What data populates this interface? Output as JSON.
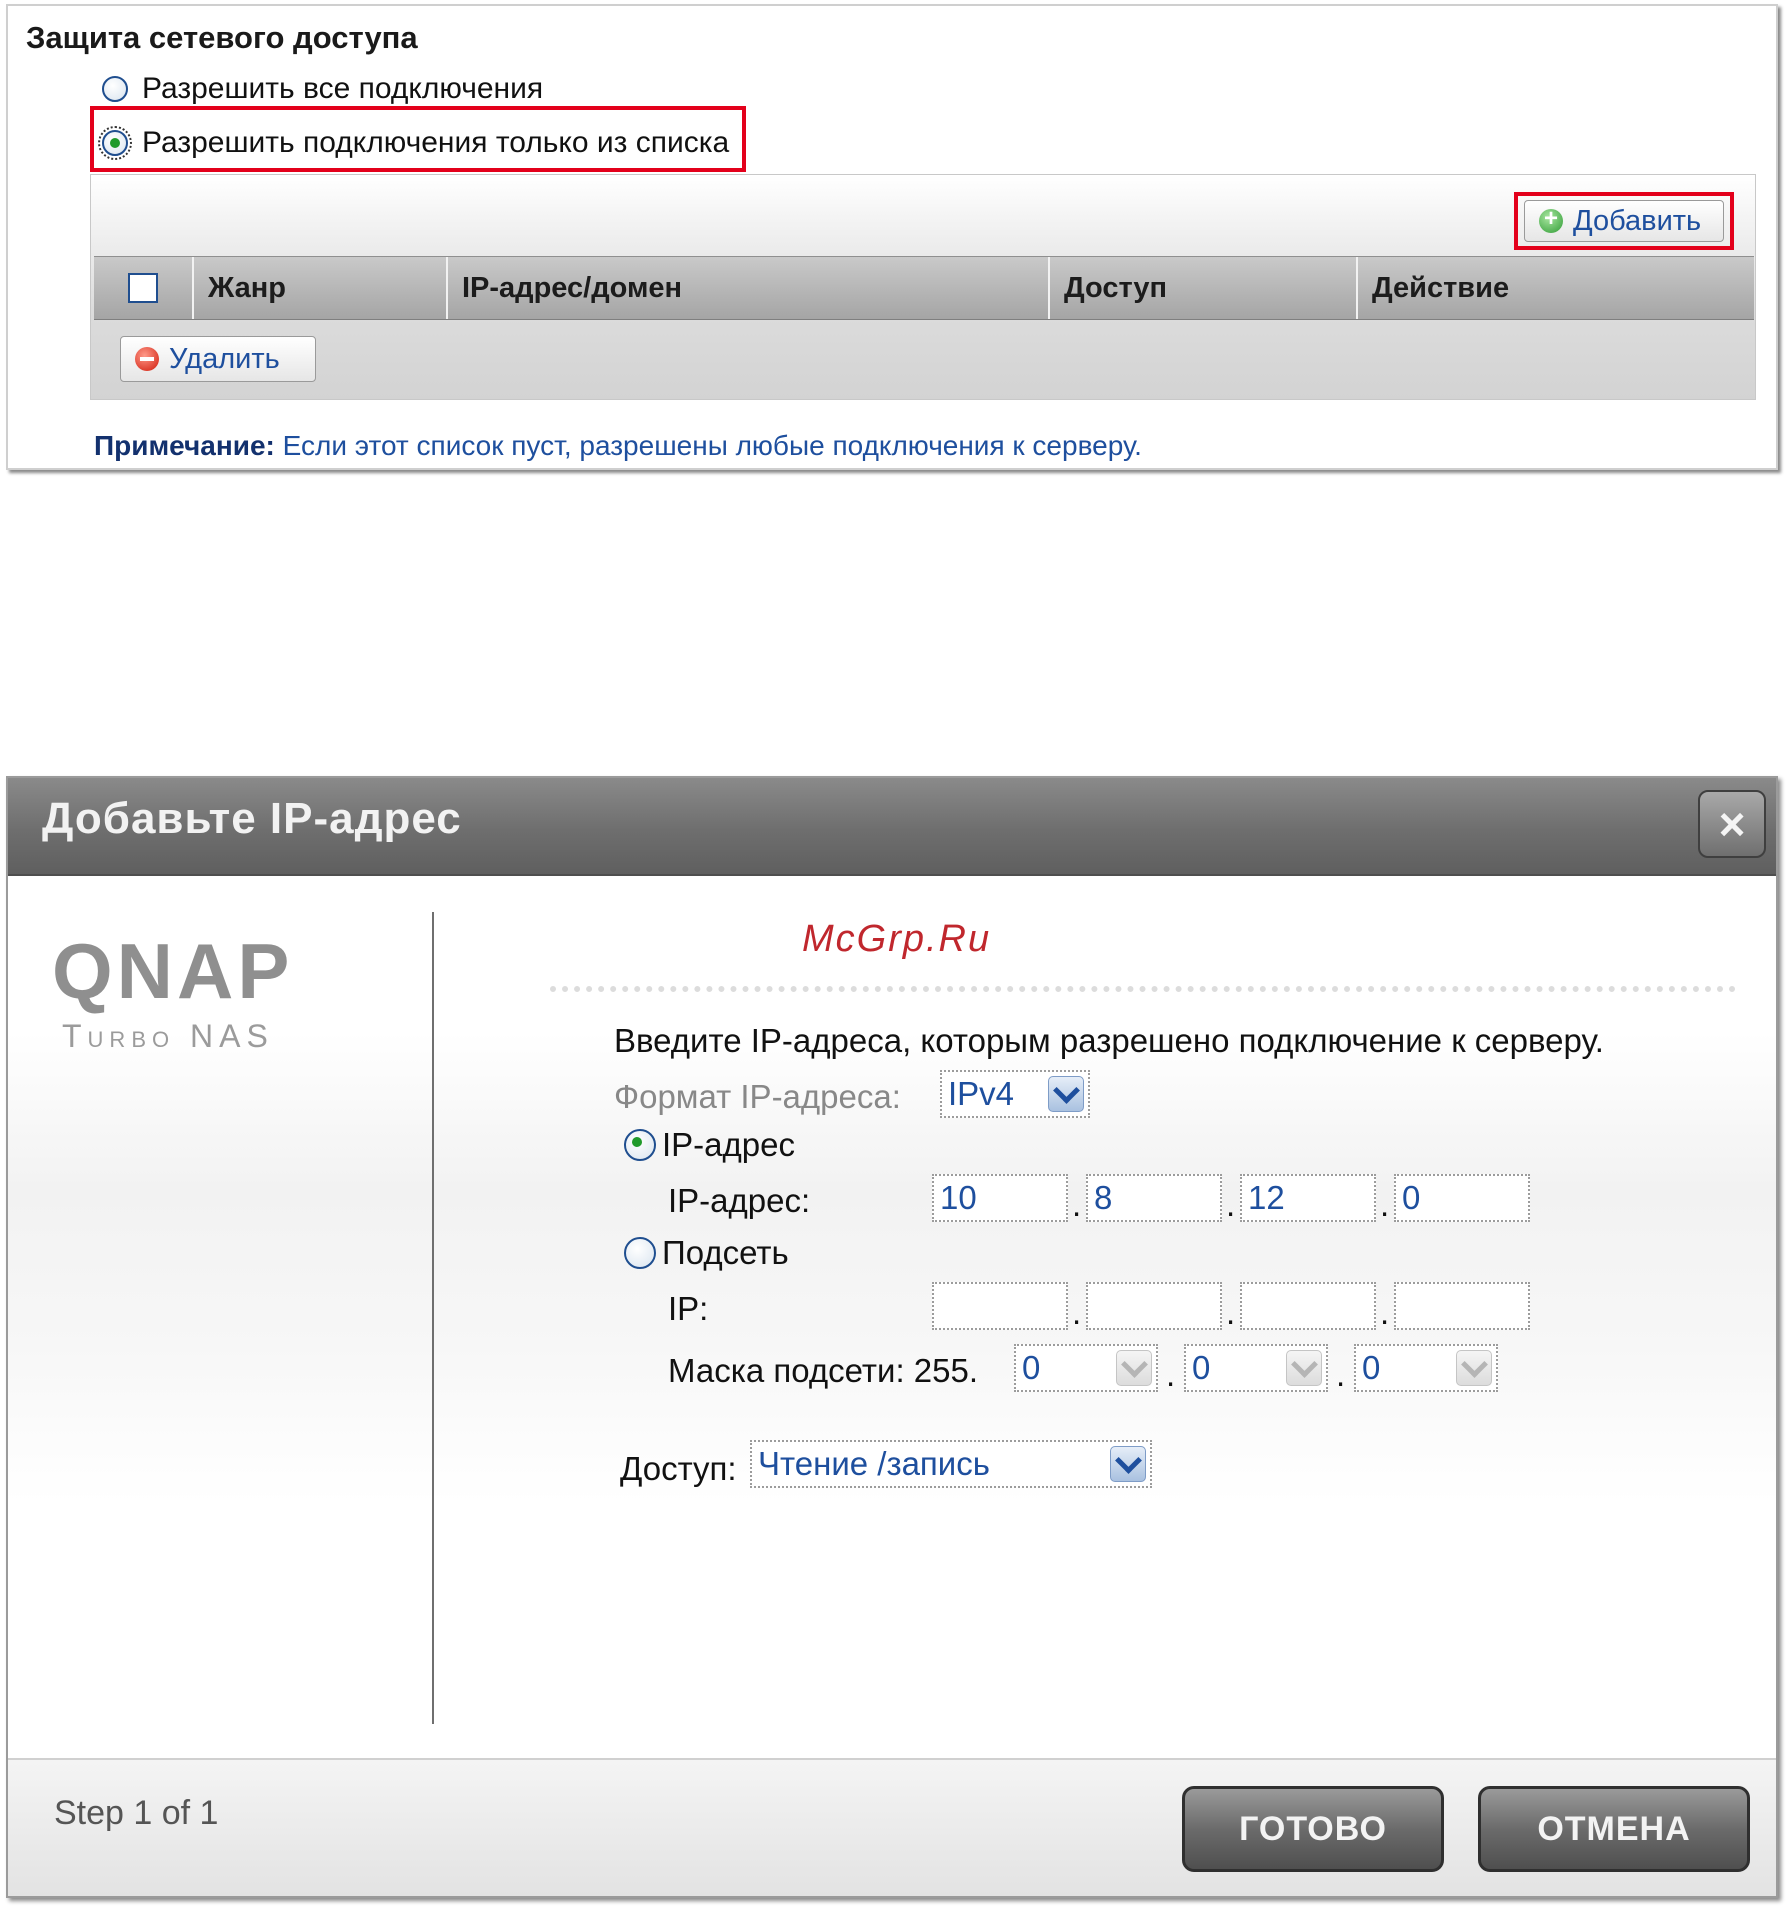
{
  "network_access": {
    "title": "Защита сетевого доступа",
    "option_all": "Разрешить все подключения",
    "option_list": "Разрешить подключения только из списка",
    "add_button": "Добавить",
    "delete_button": "Удалить",
    "columns": [
      "Жанр",
      "IP-адрес/домен",
      "Доступ",
      "Действие"
    ],
    "note_label": "Примечание:",
    "note_text": " Если этот список пуст, разрешены любые подключения к серверу."
  },
  "dialog": {
    "title": "Добавьте IP-адрес",
    "close_icon": "×",
    "logo": "QNAP",
    "logo_sub": "Turbo NAS",
    "watermark": "McGrp.Ru",
    "instruction": "Введите IP-адреса, которым разрешено подключение к серверу.",
    "format_label": "Формат IP-адреса:",
    "format_value": "IPv4",
    "ip_radio": "IP-адрес",
    "ip_label": "IP-адрес:",
    "ip_octets": [
      "10",
      "8",
      "12",
      "0"
    ],
    "subnet_radio": "Подсеть",
    "subnet_ip_label": "IP:",
    "subnet_octets": [
      "",
      "",
      "",
      ""
    ],
    "mask_label": "Маска подсети: 255.",
    "mask_octets": [
      "0",
      "0",
      "0"
    ],
    "access_label": "Доступ:",
    "access_value": "Чтение /запись",
    "step": "Step 1 of 1",
    "ok_button": "ГОТОВО",
    "cancel_button": "ОТМЕНА"
  },
  "colors": {
    "highlight_red": "#e3001b",
    "link_blue": "#1e4f9e",
    "radio_green": "#1f9a2b",
    "watermark_red": "#c0272d"
  },
  "icons": {
    "add": "plus-circle-icon",
    "delete": "minus-circle-icon",
    "close": "close-icon",
    "dropdown": "chevron-down-icon"
  }
}
